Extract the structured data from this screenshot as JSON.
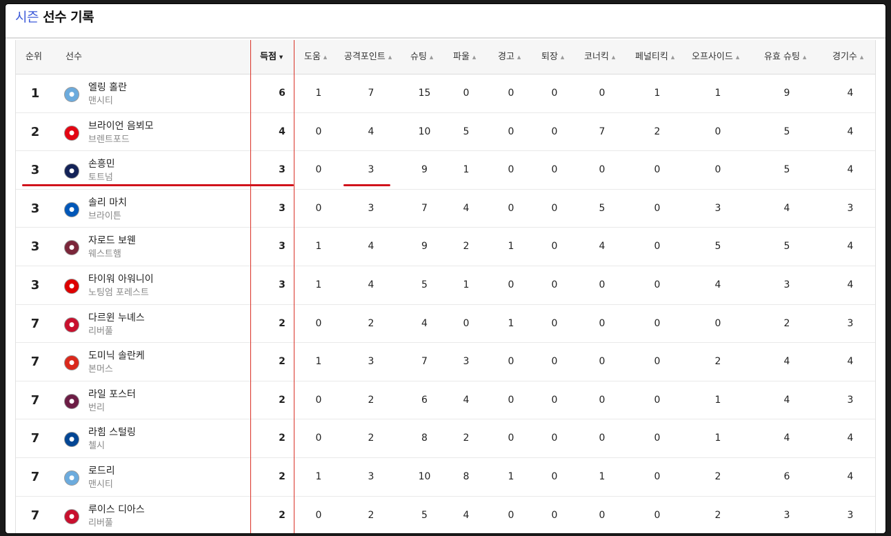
{
  "page": {
    "title_accent": "시즌",
    "title_rest": "선수 기록"
  },
  "headers": {
    "rank": "순위",
    "player": "선수",
    "goals": "득점",
    "assists": "도움",
    "attack_points": "공격포인트",
    "shots": "슈팅",
    "fouls": "파울",
    "yellow": "경고",
    "red": "퇴장",
    "corners": "코너킥",
    "penalties": "페널티킥",
    "offsides": "오프사이드",
    "on_target": "유효 슈팅",
    "games": "경기수"
  },
  "rows": [
    {
      "rank": "1",
      "name": "엘링 홀란",
      "team": "맨시티",
      "team_color": "#6cabdd",
      "goals": "6",
      "assists": "1",
      "attack_points": "7",
      "shots": "15",
      "fouls": "0",
      "yellow": "0",
      "red": "0",
      "corners": "0",
      "penalties": "1",
      "offsides": "1",
      "on_target": "9",
      "games": "4"
    },
    {
      "rank": "2",
      "name": "브라이언 음뵈모",
      "team": "브렌트포드",
      "team_color": "#e30613",
      "goals": "4",
      "assists": "0",
      "attack_points": "4",
      "shots": "10",
      "fouls": "5",
      "yellow": "0",
      "red": "0",
      "corners": "7",
      "penalties": "2",
      "offsides": "0",
      "on_target": "5",
      "games": "4"
    },
    {
      "rank": "3",
      "name": "손흥민",
      "team": "토트넘",
      "team_color": "#132257",
      "goals": "3",
      "assists": "0",
      "attack_points": "3",
      "shots": "9",
      "fouls": "1",
      "yellow": "0",
      "red": "0",
      "corners": "0",
      "penalties": "0",
      "offsides": "0",
      "on_target": "5",
      "games": "4"
    },
    {
      "rank": "3",
      "name": "솔리 마치",
      "team": "브라이튼",
      "team_color": "#0057b8",
      "goals": "3",
      "assists": "0",
      "attack_points": "3",
      "shots": "7",
      "fouls": "4",
      "yellow": "0",
      "red": "0",
      "corners": "5",
      "penalties": "0",
      "offsides": "3",
      "on_target": "4",
      "games": "3"
    },
    {
      "rank": "3",
      "name": "자로드 보웬",
      "team": "웨스트햄",
      "team_color": "#7a263a",
      "goals": "3",
      "assists": "1",
      "attack_points": "4",
      "shots": "9",
      "fouls": "2",
      "yellow": "1",
      "red": "0",
      "corners": "4",
      "penalties": "0",
      "offsides": "5",
      "on_target": "5",
      "games": "4"
    },
    {
      "rank": "3",
      "name": "타이워 아워니이",
      "team": "노팅엄 포레스트",
      "team_color": "#dd0000",
      "goals": "3",
      "assists": "1",
      "attack_points": "4",
      "shots": "5",
      "fouls": "1",
      "yellow": "0",
      "red": "0",
      "corners": "0",
      "penalties": "0",
      "offsides": "4",
      "on_target": "3",
      "games": "4"
    },
    {
      "rank": "7",
      "name": "다르윈 누녜스",
      "team": "리버풀",
      "team_color": "#c8102e",
      "goals": "2",
      "assists": "0",
      "attack_points": "2",
      "shots": "4",
      "fouls": "0",
      "yellow": "1",
      "red": "0",
      "corners": "0",
      "penalties": "0",
      "offsides": "0",
      "on_target": "2",
      "games": "3"
    },
    {
      "rank": "7",
      "name": "도미닉 솔란케",
      "team": "본머스",
      "team_color": "#da291c",
      "goals": "2",
      "assists": "1",
      "attack_points": "3",
      "shots": "7",
      "fouls": "3",
      "yellow": "0",
      "red": "0",
      "corners": "0",
      "penalties": "0",
      "offsides": "2",
      "on_target": "4",
      "games": "4"
    },
    {
      "rank": "7",
      "name": "라일 포스터",
      "team": "번리",
      "team_color": "#6c1d45",
      "goals": "2",
      "assists": "0",
      "attack_points": "2",
      "shots": "6",
      "fouls": "4",
      "yellow": "0",
      "red": "0",
      "corners": "0",
      "penalties": "0",
      "offsides": "1",
      "on_target": "4",
      "games": "3"
    },
    {
      "rank": "7",
      "name": "라힘 스털링",
      "team": "첼시",
      "team_color": "#034694",
      "goals": "2",
      "assists": "0",
      "attack_points": "2",
      "shots": "8",
      "fouls": "2",
      "yellow": "0",
      "red": "0",
      "corners": "0",
      "penalties": "0",
      "offsides": "1",
      "on_target": "4",
      "games": "4"
    },
    {
      "rank": "7",
      "name": "로드리",
      "team": "맨시티",
      "team_color": "#6cabdd",
      "goals": "2",
      "assists": "1",
      "attack_points": "3",
      "shots": "10",
      "fouls": "8",
      "yellow": "1",
      "red": "0",
      "corners": "1",
      "penalties": "0",
      "offsides": "2",
      "on_target": "6",
      "games": "4"
    },
    {
      "rank": "7",
      "name": "루이스 디아스",
      "team": "리버풀",
      "team_color": "#c8102e",
      "goals": "2",
      "assists": "0",
      "attack_points": "2",
      "shots": "5",
      "fouls": "4",
      "yellow": "0",
      "red": "0",
      "corners": "0",
      "penalties": "0",
      "offsides": "2",
      "on_target": "3",
      "games": "3"
    }
  ],
  "colors": {
    "accent": "#3d5bd9",
    "highlight": "#d0121b"
  }
}
